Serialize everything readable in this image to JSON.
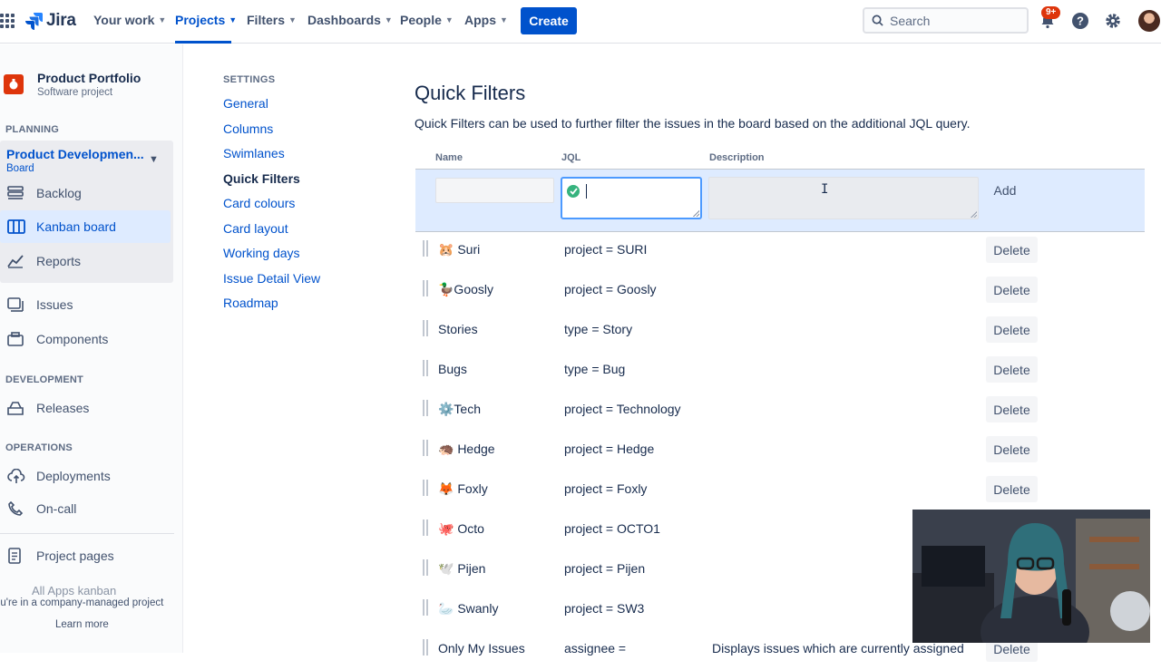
{
  "nav": {
    "logo": "Jira",
    "items": [
      {
        "label": "Your work"
      },
      {
        "label": "Projects"
      },
      {
        "label": "Filters"
      },
      {
        "label": "Dashboards"
      },
      {
        "label": "People"
      },
      {
        "label": "Apps"
      }
    ],
    "create_label": "Create",
    "search_placeholder": "Search",
    "notification_badge": "9+"
  },
  "sidebar": {
    "project_name": "Product Portfolio",
    "project_type": "Software project",
    "planning_title": "PLANNING",
    "board_name": "Product Developmen...",
    "board_type": "Board",
    "board_items": [
      {
        "label": "Backlog",
        "icon": "backlog-icon"
      },
      {
        "label": "Kanban board",
        "icon": "kanban-board-icon"
      },
      {
        "label": "Reports",
        "icon": "reports-icon"
      }
    ],
    "items": [
      {
        "label": "Issues",
        "icon": "issues-icon"
      },
      {
        "label": "Components",
        "icon": "components-icon"
      }
    ],
    "development_title": "DEVELOPMENT",
    "releases_label": "Releases",
    "operations_title": "OPERATIONS",
    "deployments_label": "Deployments",
    "oncall_label": "On-call",
    "project_pages_label": "Project pages",
    "faded_item": "All Apps kanban",
    "company_note": "ou're in a company-managed project",
    "learn_more": "Learn more"
  },
  "settings_nav": {
    "title": "SETTINGS",
    "links": [
      "General",
      "Columns",
      "Swimlanes",
      "Quick Filters",
      "Card colours",
      "Card layout",
      "Working days",
      "Issue Detail View",
      "Roadmap"
    ],
    "active": "Quick Filters"
  },
  "main": {
    "title": "Quick Filters",
    "description": "Quick Filters can be used to further filter the issues in the board based on the additional JQL query.",
    "columns": {
      "name": "Name",
      "jql": "JQL",
      "description": "Description"
    },
    "add_label": "Add",
    "delete_label": "Delete",
    "filters": [
      {
        "name": "🐹 Suri",
        "jql": "project = SURI",
        "description": ""
      },
      {
        "name": "🦆Goosly",
        "jql": "project = Goosly",
        "description": ""
      },
      {
        "name": "Stories",
        "jql": "type = Story",
        "description": ""
      },
      {
        "name": "Bugs",
        "jql": "type = Bug",
        "description": ""
      },
      {
        "name": "⚙️Tech",
        "jql": "project = Technology",
        "description": ""
      },
      {
        "name": "🦔 Hedge",
        "jql": "project = Hedge",
        "description": ""
      },
      {
        "name": "🦊 Foxly",
        "jql": "project = Foxly",
        "description": ""
      },
      {
        "name": "🐙 Octo",
        "jql": "project = OCTO1",
        "description": ""
      },
      {
        "name": "🕊️ Pijen",
        "jql": "project = Pijen",
        "description": ""
      },
      {
        "name": "🦢 Swanly",
        "jql": "project = SW3",
        "description": ""
      },
      {
        "name": "Only My Issues",
        "jql": "assignee =",
        "description": "Displays issues which are currently assigned"
      }
    ]
  },
  "colors": {
    "brand": "#0052cc",
    "nav_text": "#42526e",
    "selected_bg": "#deebff",
    "valid": "#36b37e",
    "badge": "#de350b"
  }
}
